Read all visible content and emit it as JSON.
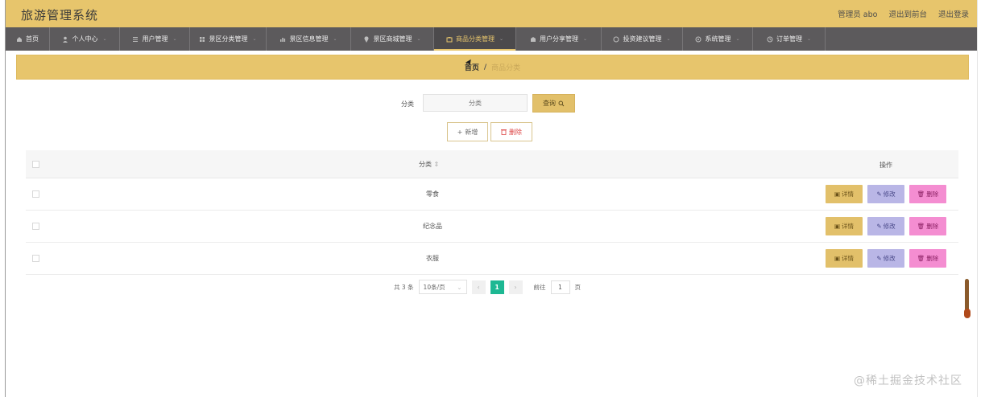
{
  "app": {
    "title": "旅游管理系统"
  },
  "header": {
    "user": "管理员 abo",
    "links": [
      "退出到前台",
      "退出登录"
    ]
  },
  "nav": {
    "items": [
      {
        "label": "首页",
        "icon": "home-icon",
        "caret": false
      },
      {
        "label": "个人中心",
        "icon": "user-icon",
        "caret": true
      },
      {
        "label": "用户管理",
        "icon": "list-icon",
        "caret": true
      },
      {
        "label": "景区分类管理",
        "icon": "grid-icon",
        "caret": true
      },
      {
        "label": "景区信息管理",
        "icon": "chart-icon",
        "caret": true
      },
      {
        "label": "景区商城管理",
        "icon": "location-icon",
        "caret": true
      },
      {
        "label": "商品分类管理",
        "icon": "box-icon",
        "caret": true,
        "active": true
      },
      {
        "label": "用户分享管理",
        "icon": "share-icon",
        "caret": true
      },
      {
        "label": "投资建议管理",
        "icon": "circle-icon",
        "caret": true
      },
      {
        "label": "系统管理",
        "icon": "settings-icon",
        "caret": true
      },
      {
        "label": "订单管理",
        "icon": "clock-icon",
        "caret": true
      }
    ]
  },
  "breadcrumb": {
    "home": "首页",
    "sep": "/",
    "current": "商品分类"
  },
  "search": {
    "label": "分类",
    "placeholder": "分类",
    "button": "查询"
  },
  "actions": {
    "add": "新增",
    "delete": "删除"
  },
  "table": {
    "columns": {
      "category": "分类",
      "ops": "操作"
    },
    "rows": [
      {
        "category": "零食"
      },
      {
        "category": "纪念品"
      },
      {
        "category": "衣服"
      }
    ],
    "ops": {
      "detail": "详情",
      "edit": "修改",
      "remove": "删除"
    }
  },
  "pagination": {
    "total": "共 3 条",
    "page_size": "10条/页",
    "current": "1",
    "goto_label": "前往",
    "goto_value": "1",
    "goto_suffix": "页"
  },
  "watermark": "@稀土掘金技术社区",
  "colors": {
    "accent": "#e7c56c",
    "nav_bg": "#5c5a5c",
    "edit": "#b9b6e6",
    "remove": "#f48dd1",
    "page_active": "#1db893"
  }
}
